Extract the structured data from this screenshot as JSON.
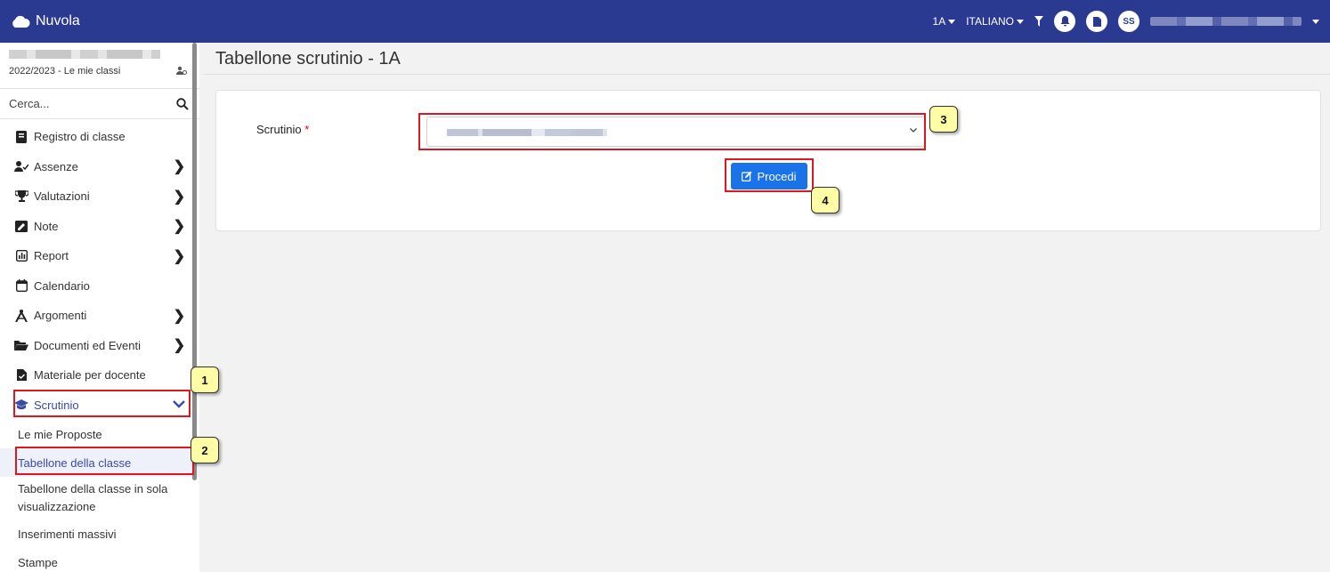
{
  "app": {
    "title": "Nuvola"
  },
  "topbar": {
    "class_selector": "1A",
    "language": "ITALIANO",
    "avatar_initials": "SS"
  },
  "sidebar": {
    "year_label": "2022/2023 - Le mie classi",
    "search_placeholder": "Cerca...",
    "items": [
      {
        "label": "Registro di classe",
        "icon": "book-icon",
        "has_submenu": false
      },
      {
        "label": "Assenze",
        "icon": "user-check-icon",
        "has_submenu": true
      },
      {
        "label": "Valutazioni",
        "icon": "trophy-icon",
        "has_submenu": true
      },
      {
        "label": "Note",
        "icon": "note-icon",
        "has_submenu": true
      },
      {
        "label": "Report",
        "icon": "chart-icon",
        "has_submenu": true
      },
      {
        "label": "Calendario",
        "icon": "calendar-icon",
        "has_submenu": false
      },
      {
        "label": "Argomenti",
        "icon": "compass-icon",
        "has_submenu": true
      },
      {
        "label": "Documenti ed Eventi",
        "icon": "folder-icon",
        "has_submenu": true
      },
      {
        "label": "Materiale per docente",
        "icon": "file-check-icon",
        "has_submenu": false
      },
      {
        "label": "Scrutinio",
        "icon": "graduation-cap-icon",
        "has_submenu": true,
        "expanded": true
      }
    ],
    "subitems": [
      {
        "label": "Le mie Proposte"
      },
      {
        "label": "Tabellone della classe",
        "active": true
      },
      {
        "label": "Tabellone della classe in sola visualizzazione"
      },
      {
        "label": "Inserimenti massivi"
      },
      {
        "label": "Stampe"
      }
    ]
  },
  "main": {
    "title": "Tabellone scrutinio - 1A",
    "form": {
      "label": "Scrutinio",
      "required_mark": "*",
      "button_label": "Procedi"
    }
  },
  "annotations": [
    "1",
    "2",
    "3",
    "4"
  ],
  "colors": {
    "topbar": "#2b3a91",
    "accent": "#3b4ca3",
    "button": "#1a73e8",
    "highlight": "#e0161e",
    "badge": "#fffca6"
  }
}
